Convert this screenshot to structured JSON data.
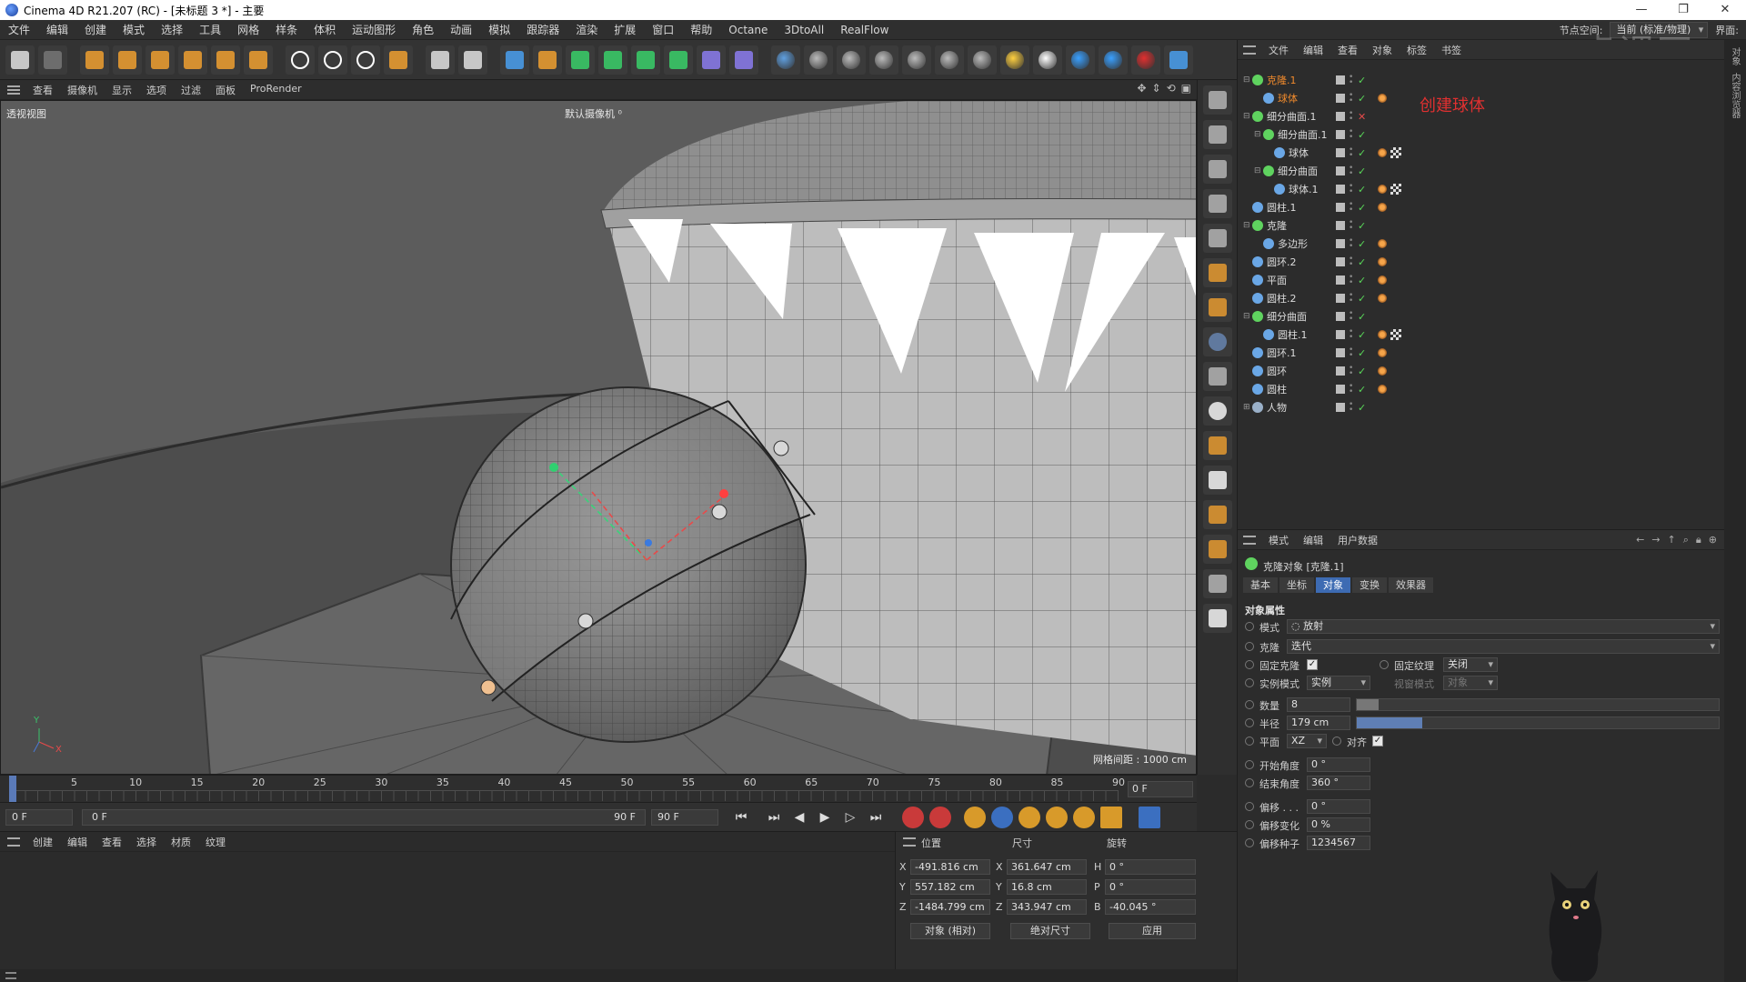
{
  "window": {
    "title": "Cinema 4D R21.207 (RC) - [未标题 3 *] - 主要"
  },
  "menubar": {
    "items": [
      "文件",
      "编辑",
      "创建",
      "模式",
      "选择",
      "工具",
      "网格",
      "样条",
      "体积",
      "运动图形",
      "角色",
      "动画",
      "模拟",
      "跟踪器",
      "渲染",
      "扩展",
      "窗口",
      "帮助",
      "Octane",
      "3DtoAll",
      "RealFlow"
    ],
    "node_space_label": "节点空间:",
    "node_space_value": "当前 (标准/物理)",
    "layout_label": "界面:"
  },
  "toolbar": {
    "icons": [
      "undo-icon",
      "redo-icon",
      "select-icon",
      "move-icon",
      "scale-icon",
      "rotate-icon",
      "psr-icon",
      "recent-tool-icon",
      "x-axis-icon",
      "y-axis-icon",
      "z-axis-icon",
      "coord-system-icon",
      "render-view-icon",
      "render-settings-icon",
      "cube-icon",
      "pen-icon",
      "subdivision-icon",
      "generator-icon",
      "cloner-icon",
      "mograph-icon",
      "deformer-icon",
      "field-icon",
      "camera-icon",
      "spline-icon",
      "material-icon",
      "sphere-light-icon",
      "floor-icon",
      "sky-icon",
      "blend-icon",
      "sun-icon",
      "white-icon",
      "light-icon",
      "contrast-icon",
      "record-icon",
      "python-icon"
    ]
  },
  "viewport": {
    "menu": [
      "查看",
      "摄像机",
      "显示",
      "选项",
      "过滤",
      "面板",
      "ProRender"
    ],
    "label": "透视视图",
    "camera": "默认摄像机 ⁰ ",
    "grid_spacing": "网格间距 : 1000 cm"
  },
  "timeline": {
    "ticks": [
      "0",
      "5",
      "10",
      "15",
      "20",
      "25",
      "30",
      "35",
      "40",
      "45",
      "50",
      "55",
      "60",
      "65",
      "70",
      "75",
      "80",
      "85",
      "90"
    ],
    "current_frame": "0 F"
  },
  "transport": {
    "start_field": "0 F",
    "range_start": "0 F",
    "range_end": "90 F",
    "end_field": "90 F"
  },
  "material": {
    "menu": [
      "创建",
      "编辑",
      "查看",
      "选择",
      "材质",
      "纹理"
    ]
  },
  "coords": {
    "headers": {
      "position": "位置",
      "size": "尺寸",
      "rotation": "旋转"
    },
    "rows": [
      {
        "axis": "X",
        "pos": "-491.816 cm",
        "size_axis": "X",
        "size": "361.647 cm",
        "rot_axis": "H",
        "rot": "0 °"
      },
      {
        "axis": "Y",
        "pos": "557.182 cm",
        "size_axis": "Y",
        "size": "16.8 cm",
        "rot_axis": "P",
        "rot": "0 °"
      },
      {
        "axis": "Z",
        "pos": "-1484.799 cm",
        "size_axis": "Z",
        "size": "343.947 cm",
        "rot_axis": "B",
        "rot": "-40.045 °"
      }
    ],
    "mode_dropdown": "对象 (相对)",
    "size_dropdown": "绝对尺寸",
    "apply_button": "应用"
  },
  "object_manager": {
    "menu": [
      "文件",
      "编辑",
      "查看",
      "对象",
      "标签",
      "书签"
    ],
    "annotation": "创建球体",
    "objects": [
      {
        "name": "克隆.1",
        "indent": 0,
        "icon_color": "#5fd35f",
        "selected": true,
        "expander": "⊟",
        "x": false,
        "tags": []
      },
      {
        "name": "球体",
        "indent": 1,
        "icon_color": "#6aa7e6",
        "selected": true,
        "expander": "",
        "x": false,
        "tags": [
          "orange"
        ]
      },
      {
        "name": "细分曲面.1",
        "indent": 0,
        "icon_color": "#5fd35f",
        "selected": false,
        "expander": "⊟",
        "x": true,
        "tags": []
      },
      {
        "name": "细分曲面.1",
        "indent": 1,
        "icon_color": "#5fd35f",
        "selected": false,
        "expander": "⊟",
        "x": false,
        "tags": []
      },
      {
        "name": "球体",
        "indent": 2,
        "icon_color": "#6aa7e6",
        "selected": false,
        "expander": "",
        "x": false,
        "tags": [
          "orange",
          "checker"
        ]
      },
      {
        "name": "细分曲面",
        "indent": 1,
        "icon_color": "#5fd35f",
        "selected": false,
        "expander": "⊟",
        "x": false,
        "tags": []
      },
      {
        "name": "球体.1",
        "indent": 2,
        "icon_color": "#6aa7e6",
        "selected": false,
        "expander": "",
        "x": false,
        "tags": [
          "orange",
          "checker"
        ]
      },
      {
        "name": "圆柱.1",
        "indent": 0,
        "icon_color": "#6aa7e6",
        "selected": false,
        "expander": "",
        "x": false,
        "tags": [
          "orange"
        ]
      },
      {
        "name": "克隆",
        "indent": 0,
        "icon_color": "#5fd35f",
        "selected": false,
        "expander": "⊟",
        "x": false,
        "tags": []
      },
      {
        "name": "多边形",
        "indent": 1,
        "icon_color": "#6aa7e6",
        "selected": false,
        "expander": "",
        "x": false,
        "tags": [
          "orange"
        ]
      },
      {
        "name": "圆环.2",
        "indent": 0,
        "icon_color": "#6aa7e6",
        "selected": false,
        "expander": "",
        "x": false,
        "tags": [
          "orange"
        ]
      },
      {
        "name": "平面",
        "indent": 0,
        "icon_color": "#6aa7e6",
        "selected": false,
        "expander": "",
        "x": false,
        "tags": [
          "orange"
        ]
      },
      {
        "name": "圆柱.2",
        "indent": 0,
        "icon_color": "#6aa7e6",
        "selected": false,
        "expander": "",
        "x": false,
        "tags": [
          "orange"
        ]
      },
      {
        "name": "细分曲面",
        "indent": 0,
        "icon_color": "#5fd35f",
        "selected": false,
        "expander": "⊟",
        "x": false,
        "tags": []
      },
      {
        "name": "圆柱.1",
        "indent": 1,
        "icon_color": "#6aa7e6",
        "selected": false,
        "expander": "",
        "x": false,
        "tags": [
          "orange",
          "checker"
        ]
      },
      {
        "name": "圆环.1",
        "indent": 0,
        "icon_color": "#6aa7e6",
        "selected": false,
        "expander": "",
        "x": false,
        "tags": [
          "orange"
        ]
      },
      {
        "name": "圆环",
        "indent": 0,
        "icon_color": "#6aa7e6",
        "selected": false,
        "expander": "",
        "x": false,
        "tags": [
          "orange"
        ]
      },
      {
        "name": "圆柱",
        "indent": 0,
        "icon_color": "#6aa7e6",
        "selected": false,
        "expander": "",
        "x": false,
        "tags": [
          "orange"
        ]
      },
      {
        "name": "人物",
        "indent": 0,
        "icon_color": "#9ab0c8",
        "selected": false,
        "expander": "⊞",
        "x": false,
        "tags": []
      }
    ]
  },
  "attributes": {
    "menu": [
      "模式",
      "编辑",
      "用户数据"
    ],
    "title": "克隆对象 [克隆.1]",
    "tabs": [
      "基本",
      "坐标",
      "对象",
      "变换",
      "效果器"
    ],
    "active_tab": "对象",
    "section": "对象属性",
    "mode_label": "模式",
    "mode_value": "◌ 放射",
    "clone_label": "克隆",
    "clone_value": "迭代",
    "fix_clone_label": "固定克隆",
    "fix_texture_label": "固定纹理",
    "fix_texture_value": "关闭",
    "instance_label": "实例模式",
    "instance_value": "实例",
    "viewport_mode_label": "视窗模式",
    "viewport_mode_value": "对象",
    "count_label": "数量",
    "count_value": "8",
    "count_fill": 0.06,
    "radius_label": "半径",
    "radius_value": "179 cm",
    "radius_fill": 0.18,
    "plane_label": "平面",
    "plane_value": "XZ",
    "align_label": "对齐",
    "start_angle_label": "开始角度",
    "start_angle_value": "0 °",
    "end_angle_label": "结束角度",
    "end_angle_value": "360 °",
    "offset_label": "偏移 . . .",
    "offset_value": "0 °",
    "offset_var_label": "偏移变化",
    "offset_var_value": "0 %",
    "offset_seed_label": "偏移种子",
    "offset_seed_value": "1234567"
  },
  "side_strip": {
    "labels": [
      "对象",
      "内容浏览器"
    ]
  },
  "colors": {
    "accent": "#3d6bb3",
    "selected_text": "#f08a2c",
    "annotation": "#e03030"
  }
}
